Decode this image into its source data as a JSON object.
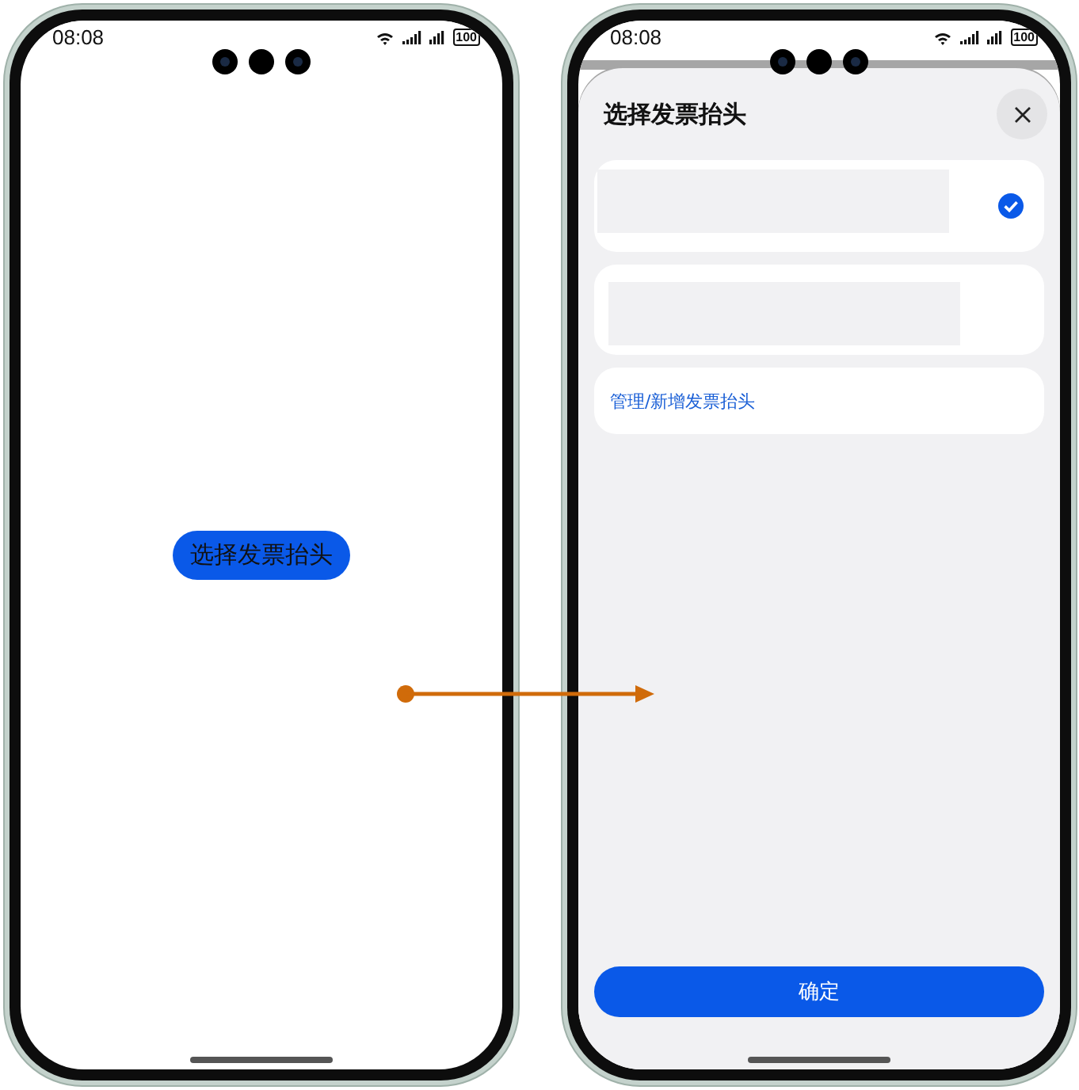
{
  "phones": [
    {
      "kind": "launcher",
      "status_bar": {
        "time": "08:08",
        "battery": "100"
      },
      "button": "选择发票抬头"
    },
    {
      "kind": "sheet",
      "status_bar": {
        "time": "08:08",
        "battery": "100"
      },
      "sheet": {
        "title": "选择发票抬头",
        "options": [
          {
            "selected": true
          },
          {
            "selected": false
          }
        ],
        "manage_link": "管理/新增发票抬头",
        "confirm_button": "确定"
      }
    }
  ]
}
